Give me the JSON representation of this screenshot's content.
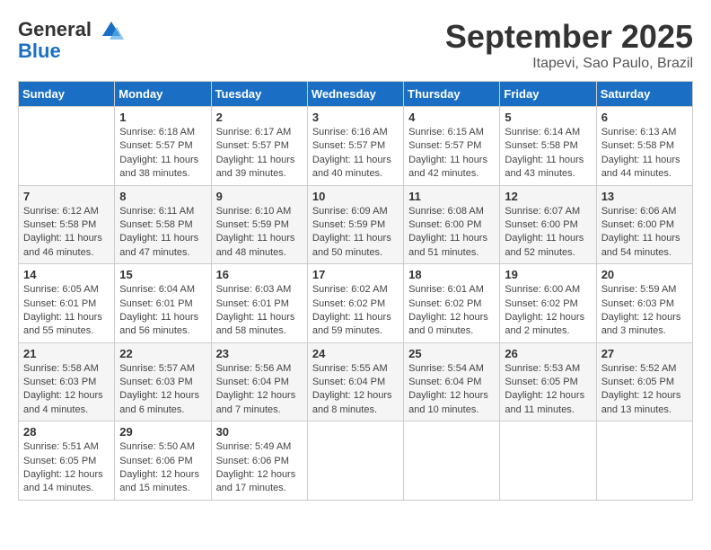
{
  "header": {
    "logo_line1": "General",
    "logo_line2": "Blue",
    "month": "September 2025",
    "location": "Itapevi, Sao Paulo, Brazil"
  },
  "weekdays": [
    "Sunday",
    "Monday",
    "Tuesday",
    "Wednesday",
    "Thursday",
    "Friday",
    "Saturday"
  ],
  "weeks": [
    [
      {
        "day": "",
        "sunrise": "",
        "sunset": "",
        "daylight": ""
      },
      {
        "day": "1",
        "sunrise": "Sunrise: 6:18 AM",
        "sunset": "Sunset: 5:57 PM",
        "daylight": "Daylight: 11 hours and 38 minutes."
      },
      {
        "day": "2",
        "sunrise": "Sunrise: 6:17 AM",
        "sunset": "Sunset: 5:57 PM",
        "daylight": "Daylight: 11 hours and 39 minutes."
      },
      {
        "day": "3",
        "sunrise": "Sunrise: 6:16 AM",
        "sunset": "Sunset: 5:57 PM",
        "daylight": "Daylight: 11 hours and 40 minutes."
      },
      {
        "day": "4",
        "sunrise": "Sunrise: 6:15 AM",
        "sunset": "Sunset: 5:57 PM",
        "daylight": "Daylight: 11 hours and 42 minutes."
      },
      {
        "day": "5",
        "sunrise": "Sunrise: 6:14 AM",
        "sunset": "Sunset: 5:58 PM",
        "daylight": "Daylight: 11 hours and 43 minutes."
      },
      {
        "day": "6",
        "sunrise": "Sunrise: 6:13 AM",
        "sunset": "Sunset: 5:58 PM",
        "daylight": "Daylight: 11 hours and 44 minutes."
      }
    ],
    [
      {
        "day": "7",
        "sunrise": "Sunrise: 6:12 AM",
        "sunset": "Sunset: 5:58 PM",
        "daylight": "Daylight: 11 hours and 46 minutes."
      },
      {
        "day": "8",
        "sunrise": "Sunrise: 6:11 AM",
        "sunset": "Sunset: 5:58 PM",
        "daylight": "Daylight: 11 hours and 47 minutes."
      },
      {
        "day": "9",
        "sunrise": "Sunrise: 6:10 AM",
        "sunset": "Sunset: 5:59 PM",
        "daylight": "Daylight: 11 hours and 48 minutes."
      },
      {
        "day": "10",
        "sunrise": "Sunrise: 6:09 AM",
        "sunset": "Sunset: 5:59 PM",
        "daylight": "Daylight: 11 hours and 50 minutes."
      },
      {
        "day": "11",
        "sunrise": "Sunrise: 6:08 AM",
        "sunset": "Sunset: 6:00 PM",
        "daylight": "Daylight: 11 hours and 51 minutes."
      },
      {
        "day": "12",
        "sunrise": "Sunrise: 6:07 AM",
        "sunset": "Sunset: 6:00 PM",
        "daylight": "Daylight: 11 hours and 52 minutes."
      },
      {
        "day": "13",
        "sunrise": "Sunrise: 6:06 AM",
        "sunset": "Sunset: 6:00 PM",
        "daylight": "Daylight: 11 hours and 54 minutes."
      }
    ],
    [
      {
        "day": "14",
        "sunrise": "Sunrise: 6:05 AM",
        "sunset": "Sunset: 6:01 PM",
        "daylight": "Daylight: 11 hours and 55 minutes."
      },
      {
        "day": "15",
        "sunrise": "Sunrise: 6:04 AM",
        "sunset": "Sunset: 6:01 PM",
        "daylight": "Daylight: 11 hours and 56 minutes."
      },
      {
        "day": "16",
        "sunrise": "Sunrise: 6:03 AM",
        "sunset": "Sunset: 6:01 PM",
        "daylight": "Daylight: 11 hours and 58 minutes."
      },
      {
        "day": "17",
        "sunrise": "Sunrise: 6:02 AM",
        "sunset": "Sunset: 6:02 PM",
        "daylight": "Daylight: 11 hours and 59 minutes."
      },
      {
        "day": "18",
        "sunrise": "Sunrise: 6:01 AM",
        "sunset": "Sunset: 6:02 PM",
        "daylight": "Daylight: 12 hours and 0 minutes."
      },
      {
        "day": "19",
        "sunrise": "Sunrise: 6:00 AM",
        "sunset": "Sunset: 6:02 PM",
        "daylight": "Daylight: 12 hours and 2 minutes."
      },
      {
        "day": "20",
        "sunrise": "Sunrise: 5:59 AM",
        "sunset": "Sunset: 6:03 PM",
        "daylight": "Daylight: 12 hours and 3 minutes."
      }
    ],
    [
      {
        "day": "21",
        "sunrise": "Sunrise: 5:58 AM",
        "sunset": "Sunset: 6:03 PM",
        "daylight": "Daylight: 12 hours and 4 minutes."
      },
      {
        "day": "22",
        "sunrise": "Sunrise: 5:57 AM",
        "sunset": "Sunset: 6:03 PM",
        "daylight": "Daylight: 12 hours and 6 minutes."
      },
      {
        "day": "23",
        "sunrise": "Sunrise: 5:56 AM",
        "sunset": "Sunset: 6:04 PM",
        "daylight": "Daylight: 12 hours and 7 minutes."
      },
      {
        "day": "24",
        "sunrise": "Sunrise: 5:55 AM",
        "sunset": "Sunset: 6:04 PM",
        "daylight": "Daylight: 12 hours and 8 minutes."
      },
      {
        "day": "25",
        "sunrise": "Sunrise: 5:54 AM",
        "sunset": "Sunset: 6:04 PM",
        "daylight": "Daylight: 12 hours and 10 minutes."
      },
      {
        "day": "26",
        "sunrise": "Sunrise: 5:53 AM",
        "sunset": "Sunset: 6:05 PM",
        "daylight": "Daylight: 12 hours and 11 minutes."
      },
      {
        "day": "27",
        "sunrise": "Sunrise: 5:52 AM",
        "sunset": "Sunset: 6:05 PM",
        "daylight": "Daylight: 12 hours and 13 minutes."
      }
    ],
    [
      {
        "day": "28",
        "sunrise": "Sunrise: 5:51 AM",
        "sunset": "Sunset: 6:05 PM",
        "daylight": "Daylight: 12 hours and 14 minutes."
      },
      {
        "day": "29",
        "sunrise": "Sunrise: 5:50 AM",
        "sunset": "Sunset: 6:06 PM",
        "daylight": "Daylight: 12 hours and 15 minutes."
      },
      {
        "day": "30",
        "sunrise": "Sunrise: 5:49 AM",
        "sunset": "Sunset: 6:06 PM",
        "daylight": "Daylight: 12 hours and 17 minutes."
      },
      {
        "day": "",
        "sunrise": "",
        "sunset": "",
        "daylight": ""
      },
      {
        "day": "",
        "sunrise": "",
        "sunset": "",
        "daylight": ""
      },
      {
        "day": "",
        "sunrise": "",
        "sunset": "",
        "daylight": ""
      },
      {
        "day": "",
        "sunrise": "",
        "sunset": "",
        "daylight": ""
      }
    ]
  ]
}
